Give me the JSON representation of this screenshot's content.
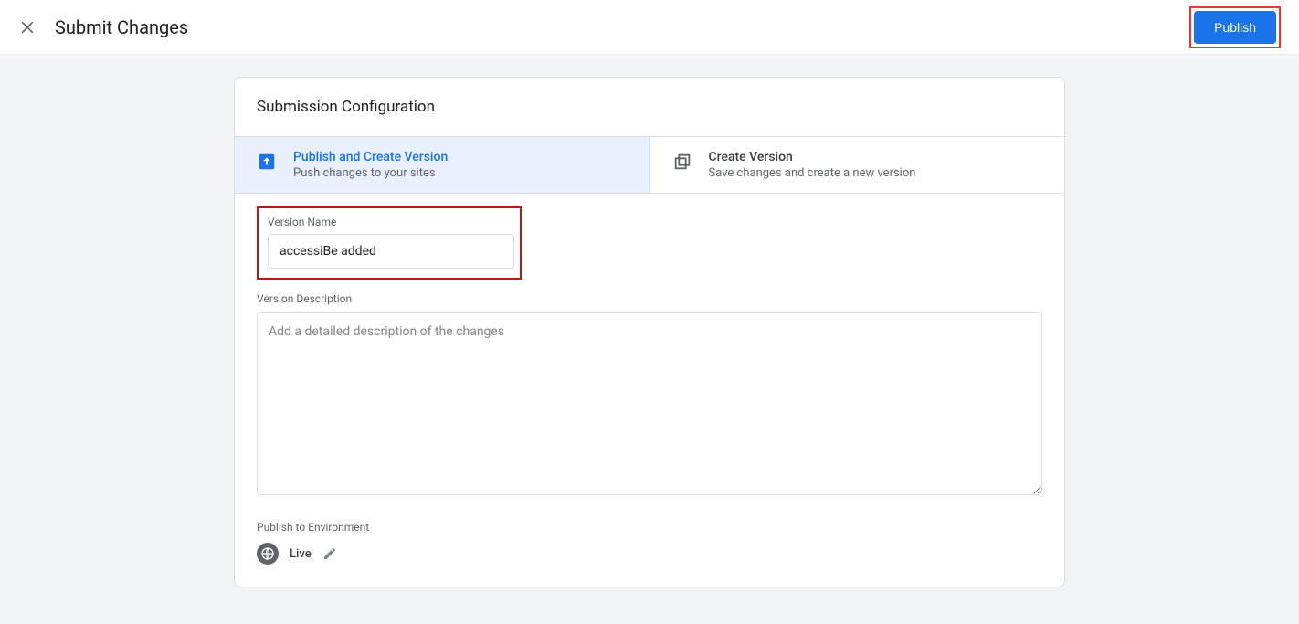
{
  "header": {
    "title": "Submit Changes",
    "publish_label": "Publish"
  },
  "card": {
    "title": "Submission Configuration"
  },
  "tabs": {
    "publish": {
      "title": "Publish and Create Version",
      "subtitle": "Push changes to your sites"
    },
    "create": {
      "title": "Create Version",
      "subtitle": "Save changes and create a new version"
    }
  },
  "form": {
    "version_name_label": "Version Name",
    "version_name_value": "accessiBe added",
    "version_description_label": "Version Description",
    "version_description_placeholder": "Add a detailed description of the changes",
    "publish_env_label": "Publish to Environment",
    "env_name": "Live"
  }
}
